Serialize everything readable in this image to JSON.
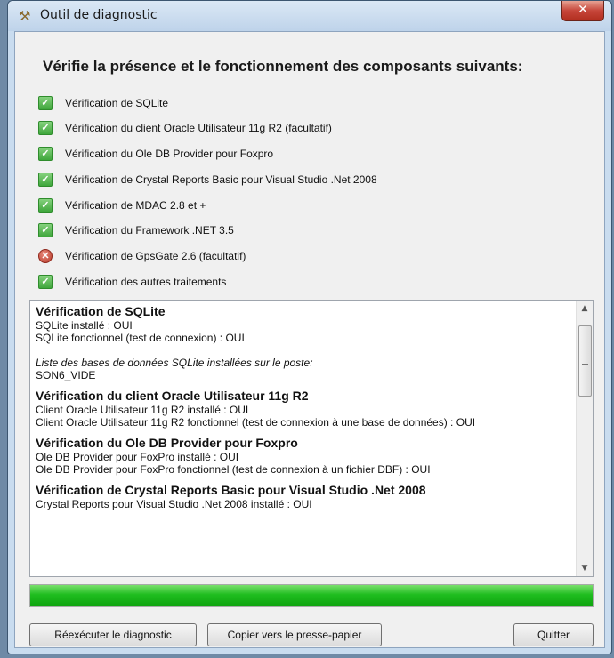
{
  "window": {
    "title": "Outil de diagnostic"
  },
  "heading": "Vérifie la présence et le fonctionnement des composants suivants:",
  "checks": [
    {
      "label": "Vérification de SQLite",
      "status": "ok"
    },
    {
      "label": "Vérification du client Oracle Utilisateur 11g R2 (facultatif)",
      "status": "ok"
    },
    {
      "label": "Vérification du Ole DB Provider pour Foxpro",
      "status": "ok"
    },
    {
      "label": "Vérification de Crystal Reports Basic pour Visual Studio .Net 2008",
      "status": "ok"
    },
    {
      "label": "Vérification de MDAC 2.8 et +",
      "status": "ok"
    },
    {
      "label": "Vérification du Framework .NET 3.5",
      "status": "ok"
    },
    {
      "label": "Vérification de GpsGate 2.6 (facultatif)",
      "status": "error"
    },
    {
      "label": "Vérification des autres traitements",
      "status": "ok"
    }
  ],
  "log": {
    "sqlite_title": "Vérification de SQLite",
    "sqlite_installed": "SQLite installé : OUI",
    "sqlite_working": "SQLite fonctionnel (test de connexion) : OUI",
    "sqlite_db_list_label": "Liste des bases de données SQLite installées sur le poste:",
    "sqlite_db_name": "SON6_VIDE",
    "oracle_title": "Vérification du client Oracle Utilisateur 11g R2",
    "oracle_installed": "Client Oracle Utilisateur 11g R2 installé : OUI",
    "oracle_working": "Client Oracle Utilisateur 11g R2 fonctionnel (test de connexion à une base de données) : OUI",
    "oledb_title": "Vérification du Ole DB Provider pour Foxpro",
    "oledb_installed": "Ole DB Provider pour FoxPro installé : OUI",
    "oledb_working": "Ole DB Provider pour FoxPro fonctionnel (test de connexion à un fichier DBF) : OUI",
    "crystal_title": "Vérification de Crystal Reports Basic pour Visual Studio .Net 2008",
    "crystal_installed": "Crystal Reports pour Visual Studio .Net 2008 installé : OUI"
  },
  "progress": {
    "value": 1.0,
    "color": "#1fbd1f"
  },
  "buttons": {
    "rerun": "Réexécuter le diagnostic",
    "copy": "Copier vers le presse-papier",
    "quit": "Quitter"
  },
  "icons": {
    "app": "tool-icon",
    "close": "close-icon",
    "ok": "check-icon",
    "error": "error-icon"
  }
}
